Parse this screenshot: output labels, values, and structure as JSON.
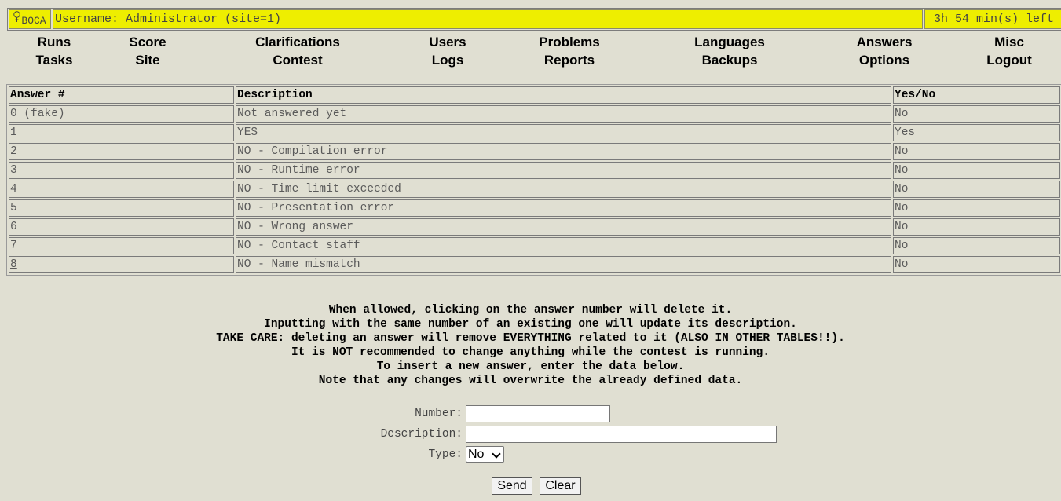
{
  "header": {
    "logo_text": "BOCA",
    "user_text": "Username: Administrator (site=1)",
    "time_left": "3h 54 min(s) left"
  },
  "menu": {
    "runs": "Runs",
    "score": "Score",
    "clarifications": "Clarifications",
    "users": "Users",
    "problems": "Problems",
    "languages": "Languages",
    "answers": "Answers",
    "misc": "Misc",
    "tasks": "Tasks",
    "site": "Site",
    "contest": "Contest",
    "logs": "Logs",
    "reports": "Reports",
    "backups": "Backups",
    "options": "Options",
    "logout": "Logout"
  },
  "table": {
    "headers": [
      "Answer #",
      "Description",
      "Yes/No"
    ],
    "rows": [
      {
        "num": "0 (fake)",
        "desc": "Not answered yet",
        "yesno": "No"
      },
      {
        "num": "1",
        "desc": "YES",
        "yesno": "Yes"
      },
      {
        "num": "2",
        "desc": "NO - Compilation error",
        "yesno": "No"
      },
      {
        "num": "3",
        "desc": "NO - Runtime error",
        "yesno": "No"
      },
      {
        "num": "4",
        "desc": "NO - Time limit exceeded",
        "yesno": "No"
      },
      {
        "num": "5",
        "desc": "NO - Presentation error",
        "yesno": "No"
      },
      {
        "num": "6",
        "desc": "NO - Wrong answer",
        "yesno": "No"
      },
      {
        "num": "7",
        "desc": "NO - Contact staff",
        "yesno": "No"
      },
      {
        "num": "8",
        "desc": "NO - Name mismatch",
        "yesno": "No"
      }
    ]
  },
  "notes": [
    "When allowed, clicking on the answer number will delete it.",
    "Inputting with the same number of an existing one will update its description.",
    "TAKE CARE: deleting an answer will remove EVERYTHING related to it (ALSO IN OTHER TABLES!!).",
    "It is NOT recommended to change anything while the contest is running.",
    "To insert a new answer, enter the data below.",
    "Note that any changes will overwrite the already defined data."
  ],
  "form": {
    "number_label": "Number:",
    "number_value": "",
    "description_label": "Description:",
    "description_value": "",
    "type_label": "Type:",
    "type_value": "No",
    "send_label": "Send",
    "clear_label": "Clear"
  }
}
